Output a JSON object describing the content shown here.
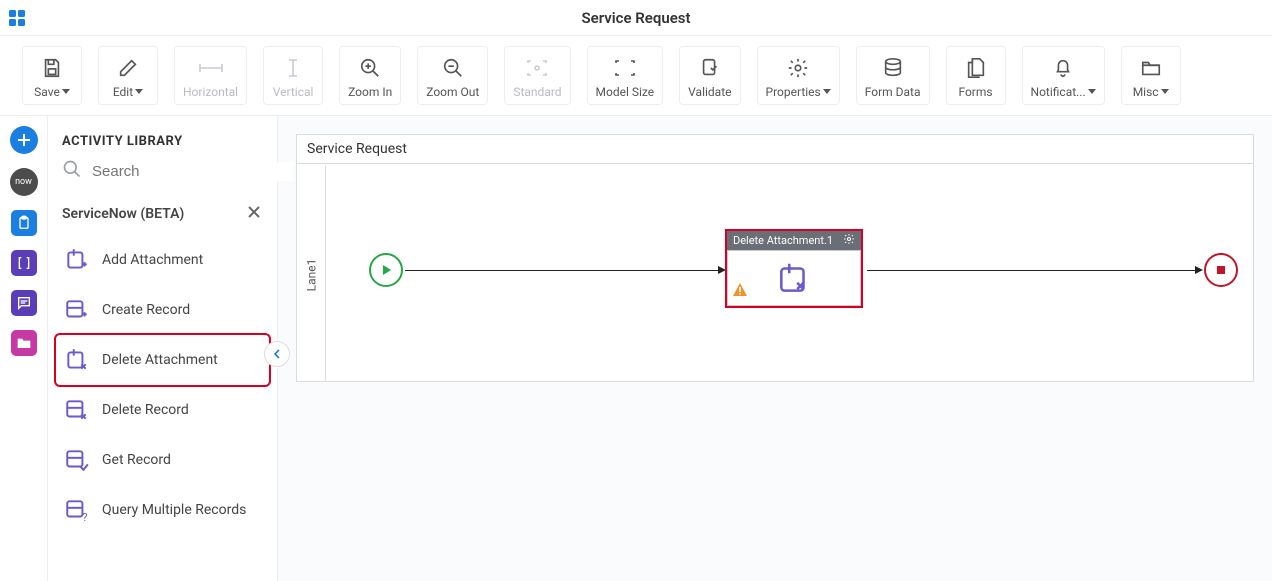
{
  "title": "Service Request",
  "toolbar": {
    "save": "Save",
    "edit": "Edit",
    "horizontal": "Horizontal",
    "vertical": "Vertical",
    "zoom_in": "Zoom In",
    "zoom_out": "Zoom Out",
    "standard": "Standard",
    "model_size": "Model Size",
    "validate": "Validate",
    "properties": "Properties",
    "form_data": "Form Data",
    "forms": "Forms",
    "notifications": "Notificat...",
    "misc": "Misc"
  },
  "sidebar": {
    "header": "ACTIVITY LIBRARY",
    "search_placeholder": "Search",
    "provider": "ServiceNow (BETA)",
    "items": [
      {
        "label": "Add Attachment"
      },
      {
        "label": "Create Record"
      },
      {
        "label": "Delete Attachment"
      },
      {
        "label": "Delete Record"
      },
      {
        "label": "Get Record"
      },
      {
        "label": "Query Multiple Records"
      }
    ]
  },
  "canvas": {
    "process_name": "Service Request",
    "lane": "Lane1",
    "activity_node": "Delete Attachment.1"
  }
}
